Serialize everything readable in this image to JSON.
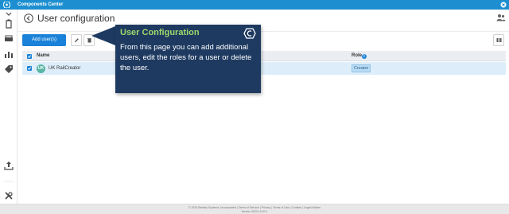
{
  "app": {
    "title": "Components Center"
  },
  "page": {
    "title": "User configuration"
  },
  "toolbar": {
    "add_label": "Add user(s)"
  },
  "table": {
    "columns": [
      "Name",
      "Role"
    ],
    "role_info": "i",
    "rows": [
      {
        "initials": "UK",
        "name": "UK RailCreator",
        "role": "Creator"
      }
    ]
  },
  "tooltip": {
    "title": "User Configuration",
    "body": "From this page you can add additional users, edit the roles for a user or delete the user."
  },
  "footer": {
    "line1": "© 2020 Bentley Systems, Incorporated | Terms of Service | Privacy | Terms of Use | Cookies | Legal Notices",
    "line2": "Version 2020.10.00.1"
  },
  "colors": {
    "accent": "#1a82d8",
    "titlebar": "#1d8fd0",
    "tooltip_bg": "#1e3a61",
    "tooltip_title": "#9fd86c"
  },
  "icons": [
    "app-logo-icon",
    "close-icon",
    "back-arrow-icon",
    "users-icon",
    "edit-icon",
    "delete-icon",
    "columns-icon",
    "upload-icon",
    "tools-icon"
  ]
}
